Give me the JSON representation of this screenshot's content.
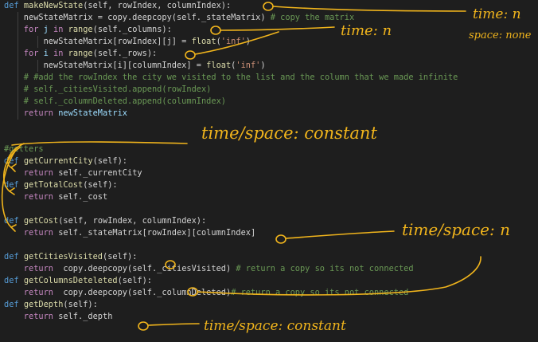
{
  "code": {
    "lines": [
      [
        [
          "kw",
          "def "
        ],
        [
          "fn",
          "makeNewState"
        ],
        [
          "plain",
          "(self, rowIndex, columnIndex):"
        ]
      ],
      [
        [
          "plain",
          "    newStateMatrix = copy.deepcopy(self._stateMatrix) "
        ],
        [
          "cm",
          "# copy the matrix"
        ]
      ],
      [
        [
          "ctl",
          "    for "
        ],
        [
          "var",
          "j "
        ],
        [
          "ctl",
          "in "
        ],
        [
          "fn",
          "range"
        ],
        [
          "plain",
          "(self._columns):"
        ]
      ],
      [
        [
          "plain",
          "        newStateMatrix[rowIndex][j] = "
        ],
        [
          "fn",
          "float"
        ],
        [
          "plain",
          "("
        ],
        [
          "str",
          "'inf'"
        ],
        [
          "plain",
          ")"
        ]
      ],
      [
        [
          "ctl",
          "    for "
        ],
        [
          "var",
          "i "
        ],
        [
          "ctl",
          "in "
        ],
        [
          "fn",
          "range"
        ],
        [
          "plain",
          "(self._rows):"
        ]
      ],
      [
        [
          "plain",
          "        newStateMatrix[i][columnIndex] = "
        ],
        [
          "fn",
          "float"
        ],
        [
          "plain",
          "("
        ],
        [
          "str",
          "'inf'"
        ],
        [
          "plain",
          ")"
        ]
      ],
      [
        [
          "cm",
          "    # #add the rowIndex the city we visited to the list and the column that we made infinite"
        ]
      ],
      [
        [
          "cm",
          "    # self._citiesVisited.append(rowIndex)"
        ]
      ],
      [
        [
          "cm",
          "    # self._columnDeleted.append(columnIndex)"
        ]
      ],
      [
        [
          "ctl",
          "    return "
        ],
        [
          "var",
          "newStateMatrix"
        ]
      ],
      [],
      [],
      [
        [
          "cm",
          "#getters"
        ]
      ],
      [
        [
          "kw",
          "def "
        ],
        [
          "fn",
          "getCurrentCity"
        ],
        [
          "plain",
          "(self):"
        ]
      ],
      [
        [
          "ctl",
          "    return "
        ],
        [
          "plain",
          "self._currentCity"
        ]
      ],
      [
        [
          "kw",
          "def "
        ],
        [
          "fn",
          "getTotalCost"
        ],
        [
          "plain",
          "(self):"
        ]
      ],
      [
        [
          "ctl",
          "    return "
        ],
        [
          "plain",
          "self._cost"
        ]
      ],
      [],
      [
        [
          "kw",
          "def "
        ],
        [
          "fn",
          "getCost"
        ],
        [
          "plain",
          "(self, rowIndex, columnIndex):"
        ]
      ],
      [
        [
          "ctl",
          "    return "
        ],
        [
          "plain",
          "self._stateMatrix[rowIndex][columnIndex]"
        ]
      ],
      [],
      [
        [
          "kw",
          "def "
        ],
        [
          "fn",
          "getCitiesVisited"
        ],
        [
          "plain",
          "(self):"
        ]
      ],
      [
        [
          "ctl",
          "    return  "
        ],
        [
          "plain",
          "copy.deepcopy(self._citiesVisited) "
        ],
        [
          "cm",
          "# return a copy so its not connected"
        ]
      ],
      [
        [
          "kw",
          "def "
        ],
        [
          "fn",
          "getColumnsDeteleted"
        ],
        [
          "plain",
          "(self):"
        ]
      ],
      [
        [
          "ctl",
          "    return  "
        ],
        [
          "plain",
          "copy.deepcopy(self._columnDeleted)"
        ],
        [
          "cm",
          "# return a copy so its not connected"
        ]
      ],
      [
        [
          "kw",
          "def "
        ],
        [
          "fn",
          "getDepth"
        ],
        [
          "plain",
          "(self):"
        ]
      ],
      [
        [
          "ctl",
          "    return "
        ],
        [
          "plain",
          "self._depth"
        ]
      ]
    ]
  },
  "annotations": {
    "note1_line1": "time: n",
    "note1_line2": "space: none",
    "note2": "time: n",
    "note3": "time/space: constant",
    "note4": "time/space: n",
    "note5": "time/space: constant"
  },
  "colors": {
    "background": "#1e1e1e",
    "keyword": "#569cd6",
    "control": "#c586c0",
    "function": "#dcdcaa",
    "variable": "#9cdcfe",
    "string": "#ce9178",
    "comment": "#6a9955",
    "ink": "#f0b41c"
  }
}
